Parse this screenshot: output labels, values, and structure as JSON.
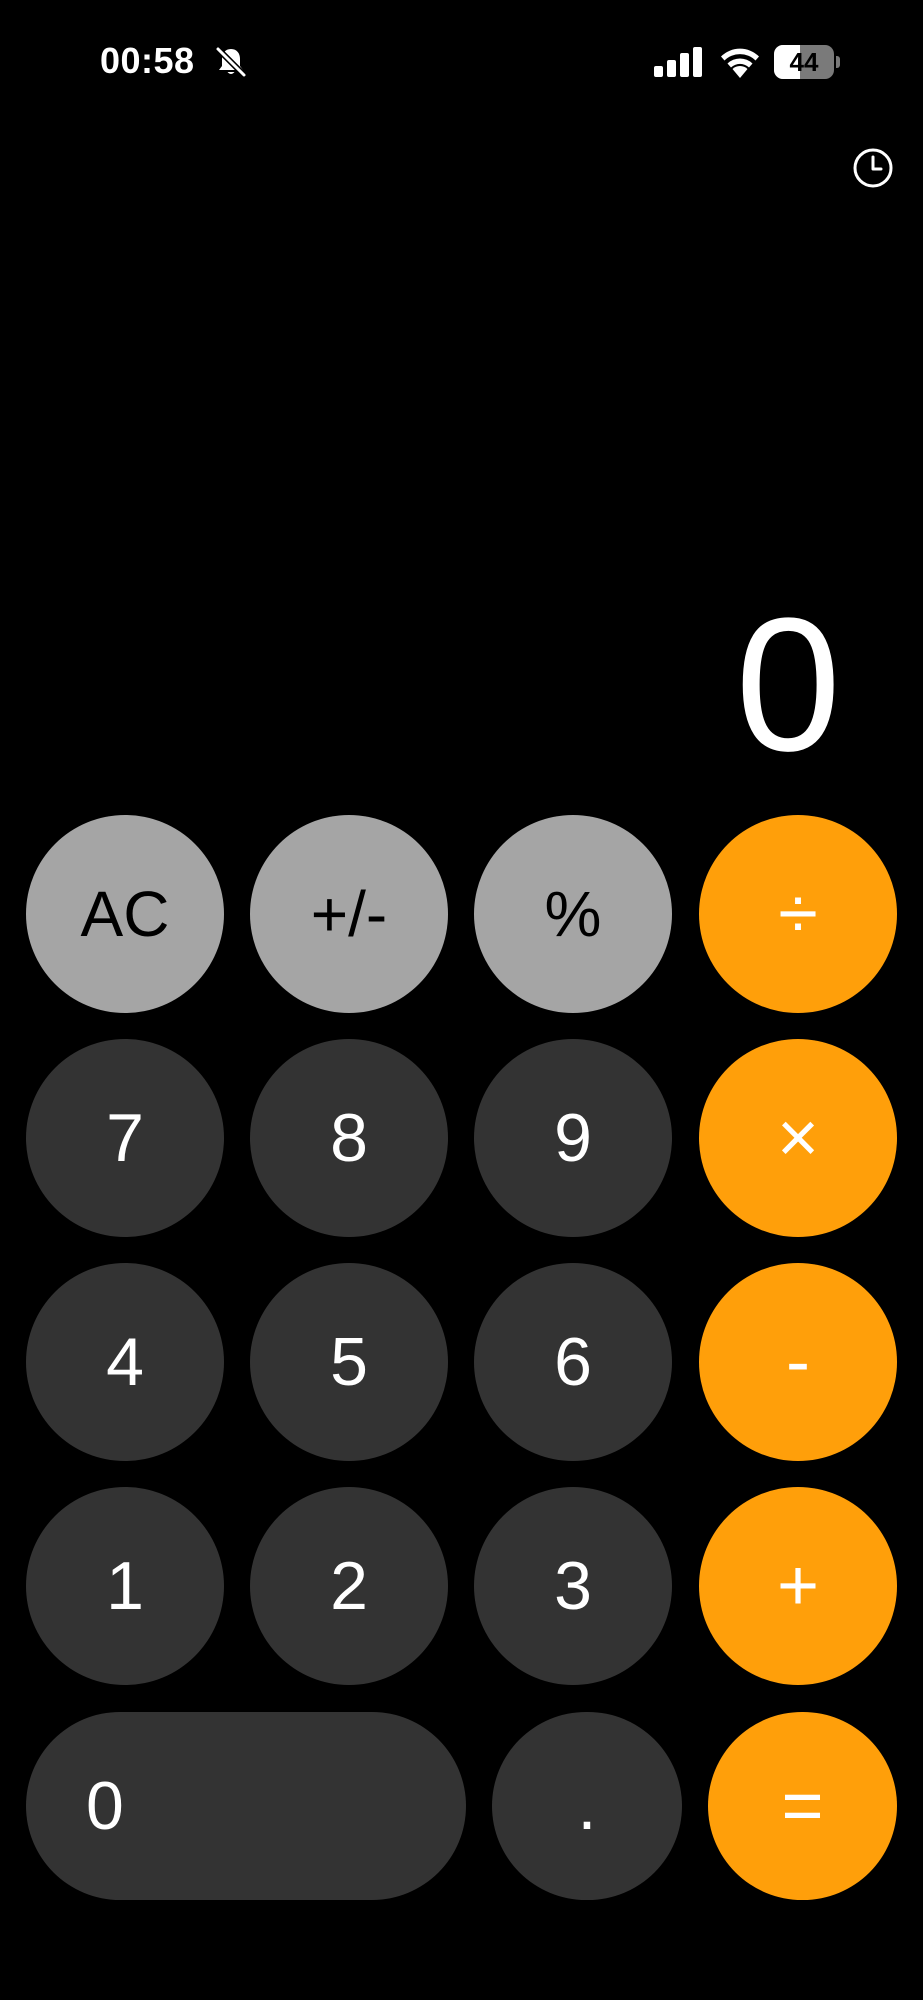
{
  "status_bar": {
    "time": "00:58",
    "battery_level": "44",
    "battery_fraction": 0.44,
    "icons": [
      "bell-slash-icon",
      "cellular-signal-icon",
      "wifi-icon",
      "battery-icon"
    ]
  },
  "history_icon": "clock-icon",
  "display": {
    "value": "0"
  },
  "keypad": {
    "ac": "AC",
    "plus_minus": "+/-",
    "percent": "%",
    "divide": "÷",
    "seven": "7",
    "eight": "8",
    "nine": "9",
    "multiply": "×",
    "four": "4",
    "five": "5",
    "six": "6",
    "minus": "-",
    "one": "1",
    "two": "2",
    "three": "3",
    "plus": "+",
    "zero": "0",
    "decimal": ".",
    "equals": "="
  },
  "colors": {
    "background": "#000000",
    "function_key": "#a5a5a5",
    "number_key": "#333333",
    "operator_key": "#ff9f0a",
    "text": "#ffffff"
  }
}
